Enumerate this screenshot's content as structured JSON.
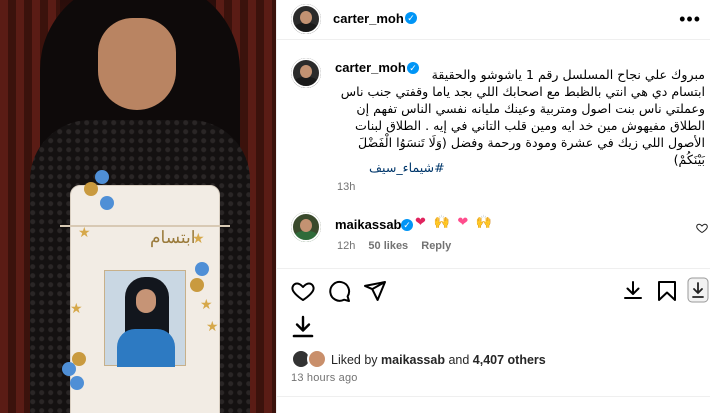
{
  "post": {
    "author": "carter_moh",
    "more_icon": "ellipsis-icon",
    "caption_author": "carter_moh",
    "caption_lines": [
      "مبروك علي نجاح المسلسل رقم 1 ياشوشو والحقيقة",
      "ابتسام دي هي انتي بالظبط مع اصحابك اللي بجد ياما وقفتي جنب ناس",
      "وعملتي ناس بنت اصول ومتربية وعينك مليانه نفسي الناس تفهم إن",
      "الطلاق مفيهوش مين خد ايه ومين قلب التاني في إيه . الطلاق لبنات",
      "الأصول اللي زيك في عشرة ومودة ورحمة وفضل (وَلَا تَنسَوُا الْفَضْلَ",
      "بَيْنَكُمْ)"
    ],
    "hashtag": "#شيماء_سيف",
    "caption_time": "13h"
  },
  "comment": {
    "user": "maikassab",
    "emojis": [
      "❤",
      "🙌",
      "❤",
      "🙌"
    ],
    "time": "12h",
    "likes": "50 likes",
    "reply": "Reply"
  },
  "actions": {
    "like_icon": "heart-icon",
    "comment_icon": "comment-icon",
    "share_icon": "send-icon",
    "download_icon": "download-icon",
    "save_icon": "bookmark-icon",
    "extra_icon": "save-to-device-icon"
  },
  "likes": {
    "prefix": "Liked by ",
    "user": "maikassab",
    "middle": " and ",
    "count": "4,407 others"
  },
  "posted_ago": "13 hours ago",
  "photo": {
    "cake_text": "ابتسام"
  }
}
